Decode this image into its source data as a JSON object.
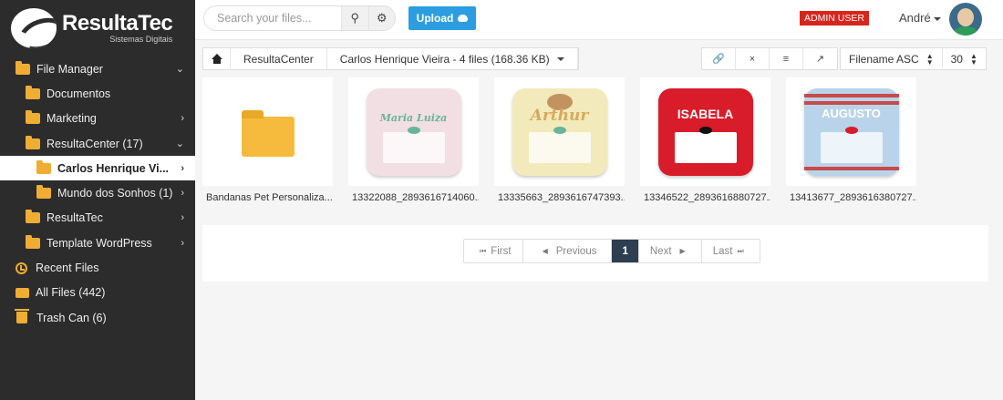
{
  "brand": {
    "title": "ResultaTec",
    "subtitle": "Sistemas Digitais"
  },
  "sidebar": {
    "items": [
      {
        "label": "File Manager",
        "icon": "folder-icon"
      },
      {
        "label": "Documentos",
        "icon": "folder-icon"
      },
      {
        "label": "Marketing",
        "icon": "folder-icon"
      },
      {
        "label": "ResultaCenter (17)",
        "icon": "folder-icon"
      },
      {
        "label": "Carlos Henrique Vi...",
        "icon": "folder-icon",
        "active": true
      },
      {
        "label": "Mundo dos Sonhos (1)",
        "icon": "folder-icon"
      },
      {
        "label": "ResultaTec",
        "icon": "folder-icon"
      },
      {
        "label": "Template WordPress",
        "icon": "folder-icon"
      },
      {
        "label": "Recent Files",
        "icon": "clock-icon"
      },
      {
        "label": "All Files (442)",
        "icon": "stack-icon"
      },
      {
        "label": "Trash Can (6)",
        "icon": "trash-icon"
      }
    ]
  },
  "topbar": {
    "search_placeholder": "Search your files...",
    "upload_label": "Upload",
    "admin_badge": "ADMIN USER",
    "user_name": "André"
  },
  "breadcrumb": {
    "root": "ResultaCenter",
    "current": "Carlos Henrique Vieira - 4 files (168.36 KB)"
  },
  "toolbar": {
    "sort_label": "Filename ASC",
    "per_page": "30"
  },
  "files": [
    {
      "name": "Bandanas Pet Personaliza...",
      "type": "folder"
    },
    {
      "name": "13322088_2893616714060...",
      "type": "image",
      "caption": "Maria Luiza"
    },
    {
      "name": "13335663_2893616747393...",
      "type": "image",
      "caption": "Arthur"
    },
    {
      "name": "13346522_2893616880727...",
      "type": "image",
      "caption": "ISABELA"
    },
    {
      "name": "13413677_2893616380727...",
      "type": "image",
      "caption": "AUGUSTO"
    }
  ],
  "pagination": {
    "first": "First",
    "previous": "Previous",
    "current": "1",
    "next": "Next",
    "last": "Last"
  },
  "colors": {
    "sidebar_bg": "#2c2c2c",
    "accent": "#2b9de0",
    "folder": "#f0ad33",
    "admin_badge": "#d9261c",
    "pager_active": "#2c3e50"
  }
}
